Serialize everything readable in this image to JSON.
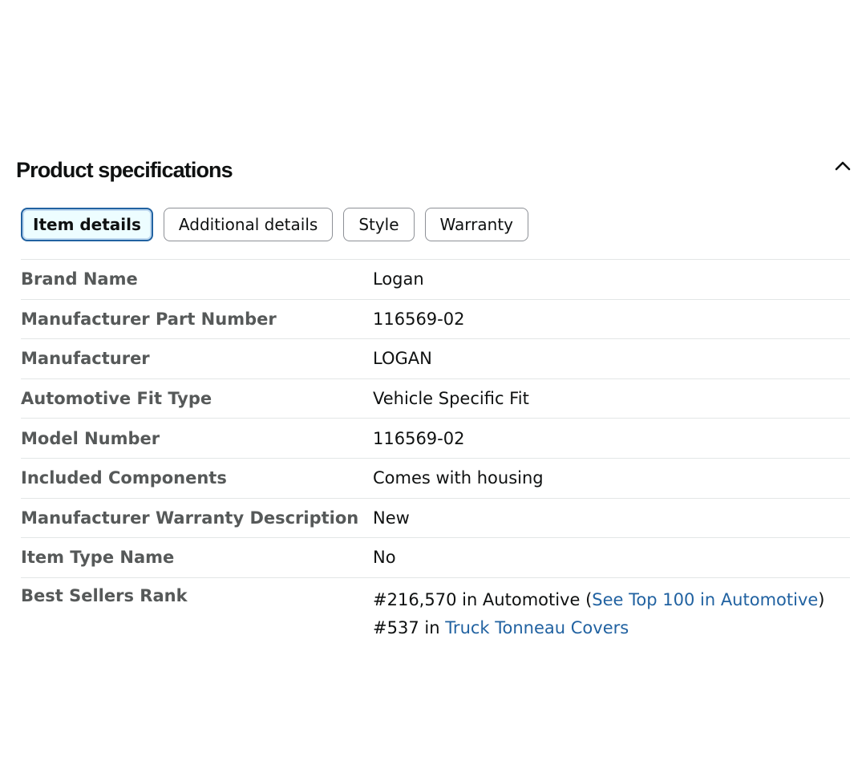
{
  "section": {
    "title": "Product specifications",
    "toggle_icon": "chevron-up-icon"
  },
  "tabs": [
    {
      "label": "Item details",
      "active": true
    },
    {
      "label": "Additional details",
      "active": false
    },
    {
      "label": "Style",
      "active": false
    },
    {
      "label": "Warranty",
      "active": false
    }
  ],
  "specs": [
    {
      "label": "Brand Name",
      "value": "Logan"
    },
    {
      "label": "Manufacturer Part Number",
      "value": "116569-02"
    },
    {
      "label": "Manufacturer",
      "value": "LOGAN"
    },
    {
      "label": "Automotive Fit Type",
      "value": "Vehicle Specific Fit"
    },
    {
      "label": "Model Number",
      "value": "116569-02"
    },
    {
      "label": "Included Components",
      "value": "Comes with housing"
    },
    {
      "label": "Manufacturer Warranty Description",
      "value": "New"
    },
    {
      "label": "Item Type Name",
      "value": "No"
    }
  ],
  "best_sellers": {
    "label": "Best Sellers Rank",
    "rank1_prefix": "#216,570 in Automotive (",
    "rank1_link": "See Top 100 in Automotive",
    "rank1_suffix": ")",
    "rank2_prefix": "#537 in ",
    "rank2_link": "Truck Tonneau Covers"
  },
  "colors": {
    "link": "#2162a1",
    "label": "#565959",
    "text": "#0f1111",
    "divider": "#e3e6e6",
    "active_tab_border": "#2162a1"
  }
}
